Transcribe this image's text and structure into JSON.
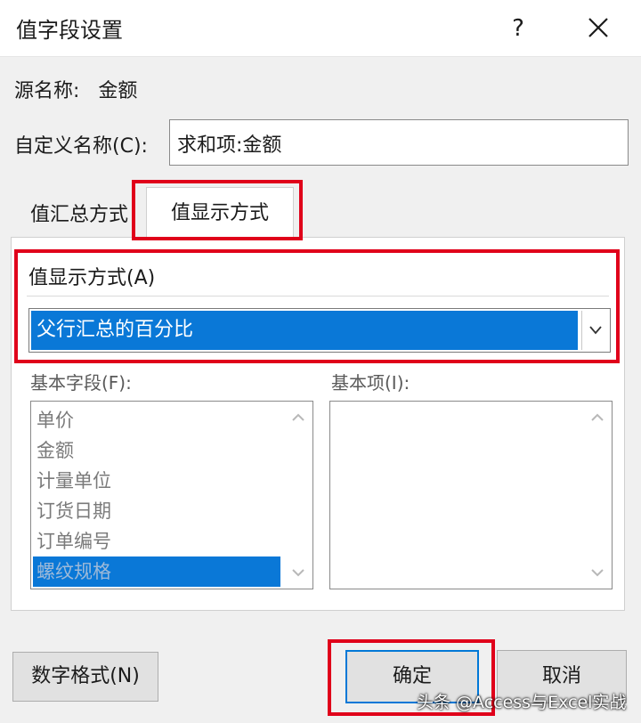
{
  "window": {
    "title": "值字段设置",
    "help": "?"
  },
  "source": {
    "label": "源名称:",
    "value": "金额"
  },
  "custom_name": {
    "label": "自定义名称(C):",
    "value": "求和项:金额"
  },
  "tabs": [
    {
      "label": "值汇总方式",
      "active": false
    },
    {
      "label": "值显示方式",
      "active": true
    }
  ],
  "show_values_as": {
    "label": "值显示方式(A)",
    "selected": "父行汇总的百分比"
  },
  "base_field": {
    "label": "基本字段(F):",
    "items": [
      "单价",
      "金额",
      "计量单位",
      "订货日期",
      "订单编号",
      "螺纹规格"
    ],
    "selected": "螺纹规格"
  },
  "base_item": {
    "label": "基本项(I):",
    "items": []
  },
  "buttons": {
    "number_format": "数字格式(N)",
    "ok": "确定",
    "cancel": "取消"
  },
  "watermark": "头条 @Access与Excel实战",
  "colors": {
    "highlight_box": "#e0001a",
    "selection": "#0a78d7"
  },
  "icons": {
    "close": "close-icon",
    "dropdown": "chevron-down-icon"
  }
}
